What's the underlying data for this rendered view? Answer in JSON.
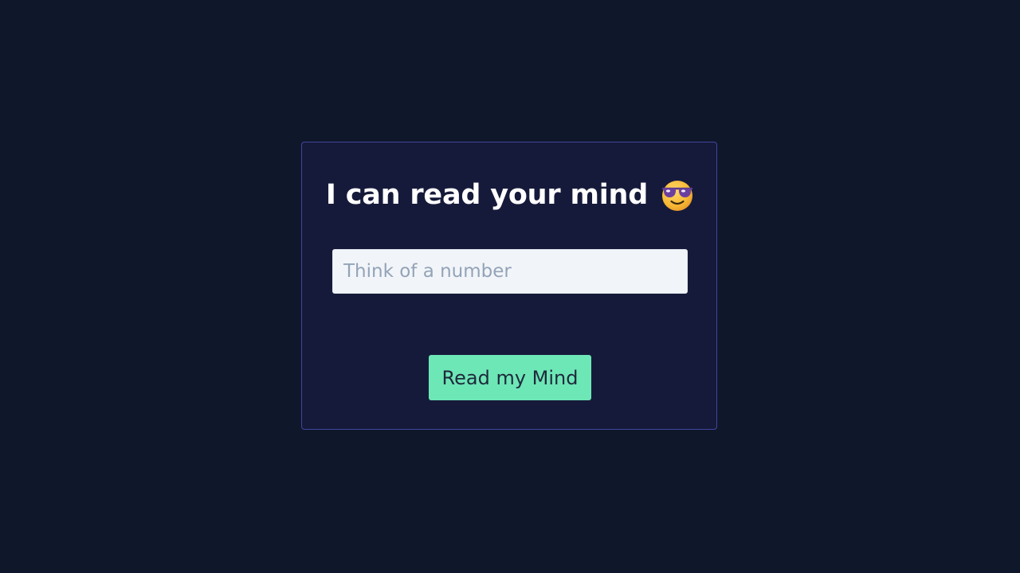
{
  "heading": {
    "text": "I can read your mind",
    "emoji_icon": "smiling-face-with-sunglasses-icon"
  },
  "number_input": {
    "placeholder": "Think of a number",
    "value": ""
  },
  "read_button": {
    "label": "Read my Mind"
  },
  "colors": {
    "page_background": "#0f172a",
    "card_background": "#161a3a",
    "card_border": "#4046a0",
    "input_background": "#f1f5f9",
    "placeholder": "#94a3b8",
    "button_background": "#6ee7b7",
    "button_text": "#1e2a3b",
    "heading_text": "#ffffff"
  }
}
